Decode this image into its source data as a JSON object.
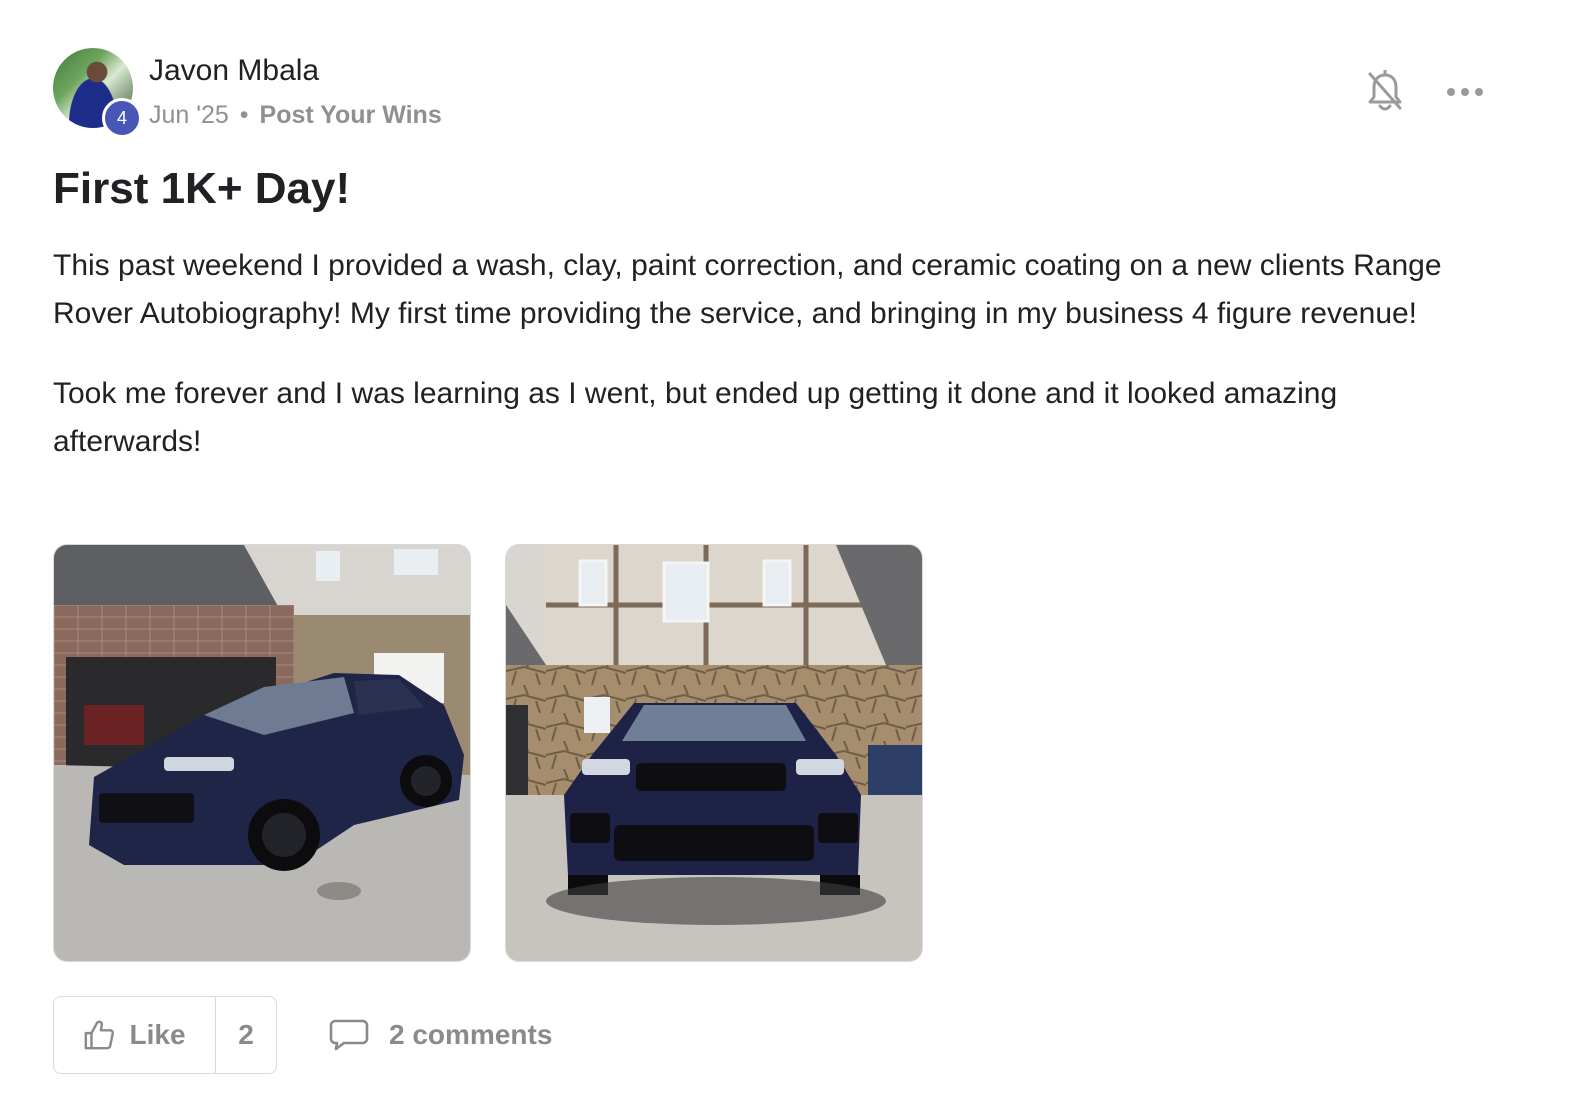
{
  "post": {
    "author": {
      "name": "Javon Mbala",
      "level": "4"
    },
    "date": "Jun '25",
    "separator": "•",
    "category": "Post Your Wins",
    "title": "First 1K+ Day!",
    "paragraphs": [
      "This past weekend I provided a wash, clay, paint correction, and ceramic coating on a new clients Range Rover Autobiography! My first time providing the service, and bringing in my business 4 figure revenue!",
      "Took me forever and I was learning as I went, but ended up getting it done and it looked amazing afterwards!"
    ],
    "actions": {
      "like_label": "Like",
      "like_count": "2",
      "comments_label": "2 comments"
    },
    "icons": {
      "notification": "bell-off-icon",
      "menu": "more-options-icon",
      "like": "thumbs-up-icon",
      "comment": "comment-icon"
    },
    "colors": {
      "level_badge": "#4657b8",
      "muted_text": "#909090",
      "title_text": "#202124"
    }
  }
}
